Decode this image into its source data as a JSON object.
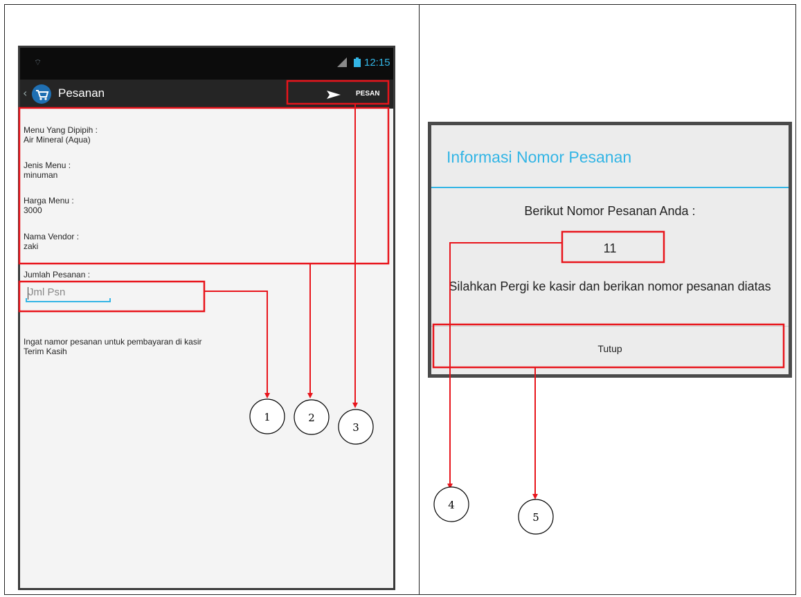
{
  "phone": {
    "status_time": "12:15",
    "status_network": "3G",
    "title": "Pesanan",
    "action_label": "PESAN",
    "fields": [
      {
        "label": "Menu Yang Dipipih :",
        "value": "Air Mineral (Aqua)"
      },
      {
        "label": "Jenis Menu :",
        "value": "minuman"
      },
      {
        "label": "Harga Menu :",
        "value": "3000"
      },
      {
        "label": "Nama Vendor :",
        "value": "zaki"
      }
    ],
    "quantity_label": "Jumlah Pesanan :",
    "quantity_placeholder": "Jml Psn",
    "note_line1": "Ingat namor pesanan untuk pembayaran di kasir",
    "note_line2": "Terim Kasih"
  },
  "dialog": {
    "title": "Informasi Nomor Pesanan",
    "heading": "Berikut Nomor Pesanan Anda :",
    "order_number": "11",
    "message": "Silahkan Pergi ke kasir dan berikan nomor pesanan diatas",
    "close_label": "Tutup"
  },
  "annotations": {
    "labels": [
      "1",
      "2",
      "3",
      "4",
      "5"
    ],
    "color": "#e8141b"
  },
  "colors": {
    "accent": "#33b5e5",
    "actionbar": "#252525",
    "statusbar": "#0c0c0c"
  }
}
